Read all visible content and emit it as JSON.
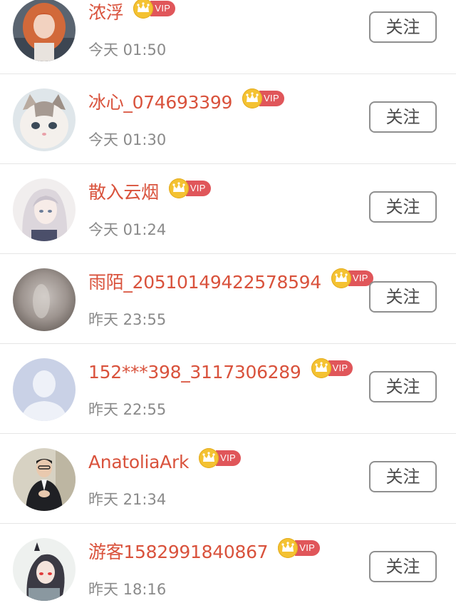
{
  "followers": [
    {
      "name": "浓浮",
      "vip_label": "VIP",
      "time": "今天 01:50",
      "follow_label": "关注",
      "avatar": "avatar-girl-red-hair"
    },
    {
      "name": "冰心_074693399",
      "vip_label": "VIP",
      "time": "今天 01:30",
      "follow_label": "关注",
      "avatar": "avatar-cat"
    },
    {
      "name": "散入云烟",
      "vip_label": "VIP",
      "time": "今天 01:24",
      "follow_label": "关注",
      "avatar": "avatar-anime-girl"
    },
    {
      "name": "雨陌_20510149422578594",
      "vip_label": "VIP",
      "time": "昨天 23:55",
      "follow_label": "关注",
      "avatar": "avatar-blurry-photo"
    },
    {
      "name": "152***398_3117306289",
      "vip_label": "VIP",
      "time": "昨天 22:55",
      "follow_label": "关注",
      "avatar": "avatar-default-silhouette"
    },
    {
      "name": "AnatoliaArk",
      "vip_label": "VIP",
      "time": "昨天 21:34",
      "follow_label": "关注",
      "avatar": "avatar-man-in-suit"
    },
    {
      "name": "游客1582991840867",
      "vip_label": "VIP",
      "time": "昨天 18:16",
      "follow_label": "关注",
      "avatar": "avatar-anime-warrior"
    }
  ],
  "colors": {
    "name": "#d9523c",
    "vip_badge": "#e0565a",
    "vip_crown": "#f4c232",
    "time": "#8a8a8a",
    "button_border": "#8f8f8f"
  }
}
